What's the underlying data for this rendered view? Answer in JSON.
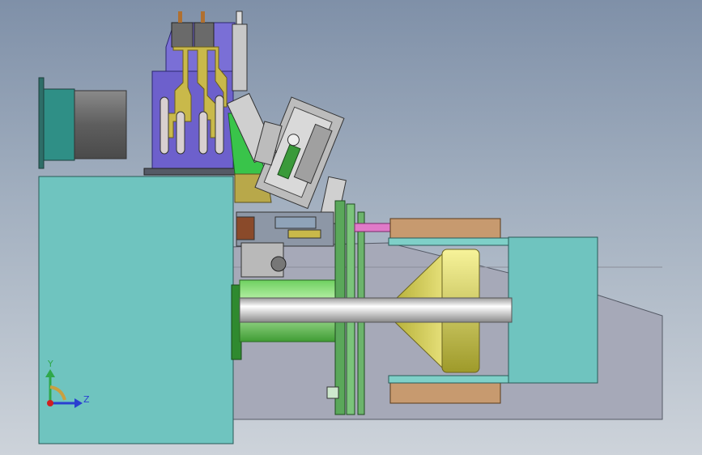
{
  "axes": {
    "y_label": "Y",
    "z_label": "Z",
    "y_color": "#2fa84a",
    "z_color": "#2a3fd0",
    "origin_color": "#d02020"
  },
  "colors": {
    "teal": "#6dc3bd",
    "teal_dark": "#2f8f86",
    "gray_body": "#9fa3b3",
    "purple_frame": "#6a5cc9",
    "mustard": "#b8a84a",
    "green_shaft": "#86e07a",
    "silver": "#dcdcdc",
    "gold_cone": "#cfc94a",
    "copper_block": "#c79a6f",
    "pink_rod": "#e07ac8"
  }
}
